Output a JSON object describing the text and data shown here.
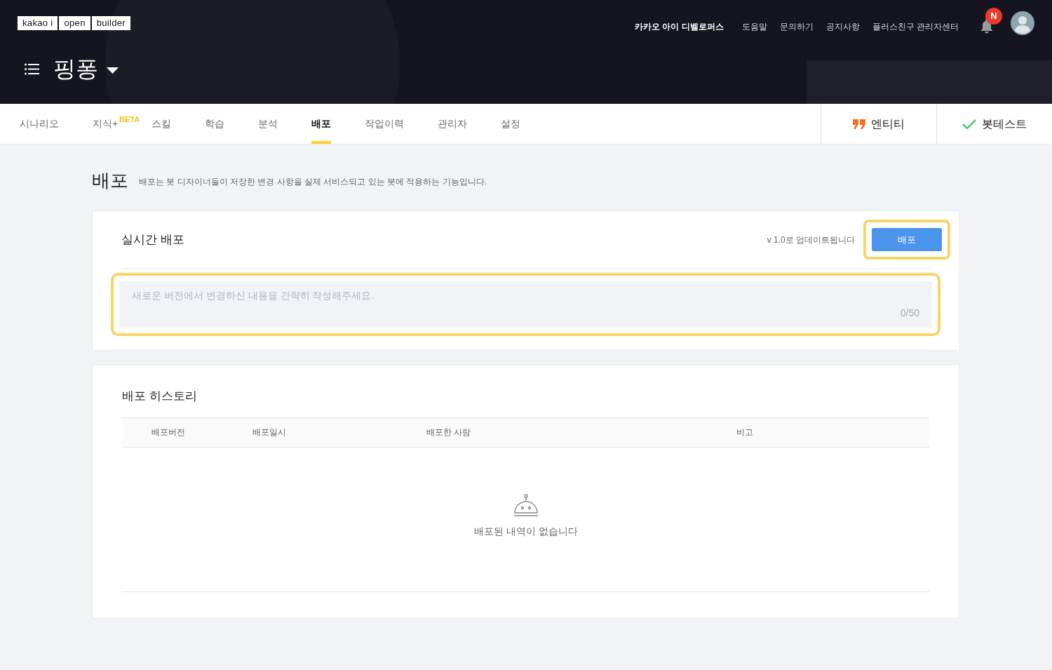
{
  "header": {
    "logo": [
      "kakao i",
      "open",
      "builder"
    ],
    "nav_links": [
      {
        "label": "카카오 아이 디벨로퍼스",
        "kind": "primary"
      },
      {
        "label": "도움말",
        "kind": "link"
      },
      {
        "label": "문의하기",
        "kind": "link"
      },
      {
        "label": "공지사항",
        "kind": "link"
      },
      {
        "label": "플러스친구 관리자센터",
        "kind": "link"
      }
    ],
    "notification_badge": "N",
    "bot_name": "핑퐁"
  },
  "tabs": [
    {
      "label": "시나리오",
      "selected": false
    },
    {
      "label": "지식+",
      "selected": false,
      "badge": "BETA"
    },
    {
      "label": "스킬",
      "selected": false
    },
    {
      "label": "학습",
      "selected": false
    },
    {
      "label": "분석",
      "selected": false
    },
    {
      "label": "배포",
      "selected": true
    },
    {
      "label": "작업이력",
      "selected": false
    },
    {
      "label": "관리자",
      "selected": false
    },
    {
      "label": "설정",
      "selected": false
    }
  ],
  "side_buttons": [
    {
      "kind": "entity",
      "label": "엔티티"
    },
    {
      "kind": "bottest",
      "label": "봇테스트"
    }
  ],
  "page": {
    "title": "배포",
    "description": "배포는 봇 디자이너들이 저장한 변경 사항을 실제 서비스되고 있는 봇에 적용하는 기능입니다."
  },
  "deploy_card": {
    "title": "실시간 배포",
    "version_note": "v 1.0로 업데이트됩니다",
    "button": "배포",
    "placeholder": "새로운 버전에서 변경하신 내용을 간략히 작성해주세요.",
    "counter": "0/50"
  },
  "history_card": {
    "title": "배포 히스토리",
    "columns": [
      "배포버전",
      "배포일시",
      "배포한 사람",
      "비고"
    ],
    "empty_message": "배포된 내역이 없습니다"
  }
}
